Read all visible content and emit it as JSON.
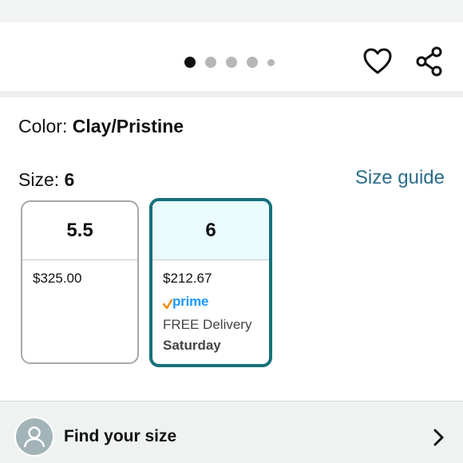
{
  "carousel": {
    "dots": [
      {
        "state": "active"
      },
      {
        "state": "inactive"
      },
      {
        "state": "inactive"
      },
      {
        "state": "inactive"
      },
      {
        "state": "small"
      }
    ],
    "icons": [
      "heart-icon",
      "share-icon"
    ]
  },
  "color": {
    "label": "Color:",
    "value": "Clay/Pristine"
  },
  "size": {
    "label": "Size:",
    "value": "6",
    "guide_link": "Size guide",
    "options": [
      {
        "size": "5.5",
        "price": "$325.00",
        "selected": false
      },
      {
        "size": "6",
        "price": "$212.67",
        "selected": true,
        "badge": "prime",
        "delivery": "FREE Delivery",
        "delivery_day": "Saturday"
      }
    ]
  },
  "find_size": {
    "label": "Find your size",
    "icons": [
      "user-avatar-icon",
      "chevron-right-icon"
    ]
  },
  "colors": {
    "accent": "#16707b",
    "link": "#2a6c8a",
    "selected_bg": "#eafbfd",
    "prime_blue": "#1a98ff",
    "prime_check": "#f08804"
  }
}
